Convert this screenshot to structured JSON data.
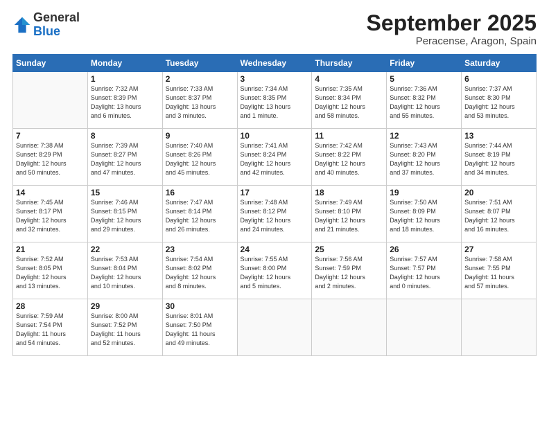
{
  "logo": {
    "general": "General",
    "blue": "Blue"
  },
  "header": {
    "month": "September 2025",
    "location": "Peracense, Aragon, Spain"
  },
  "weekdays": [
    "Sunday",
    "Monday",
    "Tuesday",
    "Wednesday",
    "Thursday",
    "Friday",
    "Saturday"
  ],
  "weeks": [
    [
      {
        "day": "",
        "info": ""
      },
      {
        "day": "1",
        "info": "Sunrise: 7:32 AM\nSunset: 8:39 PM\nDaylight: 13 hours\nand 6 minutes."
      },
      {
        "day": "2",
        "info": "Sunrise: 7:33 AM\nSunset: 8:37 PM\nDaylight: 13 hours\nand 3 minutes."
      },
      {
        "day": "3",
        "info": "Sunrise: 7:34 AM\nSunset: 8:35 PM\nDaylight: 13 hours\nand 1 minute."
      },
      {
        "day": "4",
        "info": "Sunrise: 7:35 AM\nSunset: 8:34 PM\nDaylight: 12 hours\nand 58 minutes."
      },
      {
        "day": "5",
        "info": "Sunrise: 7:36 AM\nSunset: 8:32 PM\nDaylight: 12 hours\nand 55 minutes."
      },
      {
        "day": "6",
        "info": "Sunrise: 7:37 AM\nSunset: 8:30 PM\nDaylight: 12 hours\nand 53 minutes."
      }
    ],
    [
      {
        "day": "7",
        "info": "Sunrise: 7:38 AM\nSunset: 8:29 PM\nDaylight: 12 hours\nand 50 minutes."
      },
      {
        "day": "8",
        "info": "Sunrise: 7:39 AM\nSunset: 8:27 PM\nDaylight: 12 hours\nand 47 minutes."
      },
      {
        "day": "9",
        "info": "Sunrise: 7:40 AM\nSunset: 8:26 PM\nDaylight: 12 hours\nand 45 minutes."
      },
      {
        "day": "10",
        "info": "Sunrise: 7:41 AM\nSunset: 8:24 PM\nDaylight: 12 hours\nand 42 minutes."
      },
      {
        "day": "11",
        "info": "Sunrise: 7:42 AM\nSunset: 8:22 PM\nDaylight: 12 hours\nand 40 minutes."
      },
      {
        "day": "12",
        "info": "Sunrise: 7:43 AM\nSunset: 8:20 PM\nDaylight: 12 hours\nand 37 minutes."
      },
      {
        "day": "13",
        "info": "Sunrise: 7:44 AM\nSunset: 8:19 PM\nDaylight: 12 hours\nand 34 minutes."
      }
    ],
    [
      {
        "day": "14",
        "info": "Sunrise: 7:45 AM\nSunset: 8:17 PM\nDaylight: 12 hours\nand 32 minutes."
      },
      {
        "day": "15",
        "info": "Sunrise: 7:46 AM\nSunset: 8:15 PM\nDaylight: 12 hours\nand 29 minutes."
      },
      {
        "day": "16",
        "info": "Sunrise: 7:47 AM\nSunset: 8:14 PM\nDaylight: 12 hours\nand 26 minutes."
      },
      {
        "day": "17",
        "info": "Sunrise: 7:48 AM\nSunset: 8:12 PM\nDaylight: 12 hours\nand 24 minutes."
      },
      {
        "day": "18",
        "info": "Sunrise: 7:49 AM\nSunset: 8:10 PM\nDaylight: 12 hours\nand 21 minutes."
      },
      {
        "day": "19",
        "info": "Sunrise: 7:50 AM\nSunset: 8:09 PM\nDaylight: 12 hours\nand 18 minutes."
      },
      {
        "day": "20",
        "info": "Sunrise: 7:51 AM\nSunset: 8:07 PM\nDaylight: 12 hours\nand 16 minutes."
      }
    ],
    [
      {
        "day": "21",
        "info": "Sunrise: 7:52 AM\nSunset: 8:05 PM\nDaylight: 12 hours\nand 13 minutes."
      },
      {
        "day": "22",
        "info": "Sunrise: 7:53 AM\nSunset: 8:04 PM\nDaylight: 12 hours\nand 10 minutes."
      },
      {
        "day": "23",
        "info": "Sunrise: 7:54 AM\nSunset: 8:02 PM\nDaylight: 12 hours\nand 8 minutes."
      },
      {
        "day": "24",
        "info": "Sunrise: 7:55 AM\nSunset: 8:00 PM\nDaylight: 12 hours\nand 5 minutes."
      },
      {
        "day": "25",
        "info": "Sunrise: 7:56 AM\nSunset: 7:59 PM\nDaylight: 12 hours\nand 2 minutes."
      },
      {
        "day": "26",
        "info": "Sunrise: 7:57 AM\nSunset: 7:57 PM\nDaylight: 12 hours\nand 0 minutes."
      },
      {
        "day": "27",
        "info": "Sunrise: 7:58 AM\nSunset: 7:55 PM\nDaylight: 11 hours\nand 57 minutes."
      }
    ],
    [
      {
        "day": "28",
        "info": "Sunrise: 7:59 AM\nSunset: 7:54 PM\nDaylight: 11 hours\nand 54 minutes."
      },
      {
        "day": "29",
        "info": "Sunrise: 8:00 AM\nSunset: 7:52 PM\nDaylight: 11 hours\nand 52 minutes."
      },
      {
        "day": "30",
        "info": "Sunrise: 8:01 AM\nSunset: 7:50 PM\nDaylight: 11 hours\nand 49 minutes."
      },
      {
        "day": "",
        "info": ""
      },
      {
        "day": "",
        "info": ""
      },
      {
        "day": "",
        "info": ""
      },
      {
        "day": "",
        "info": ""
      }
    ]
  ]
}
